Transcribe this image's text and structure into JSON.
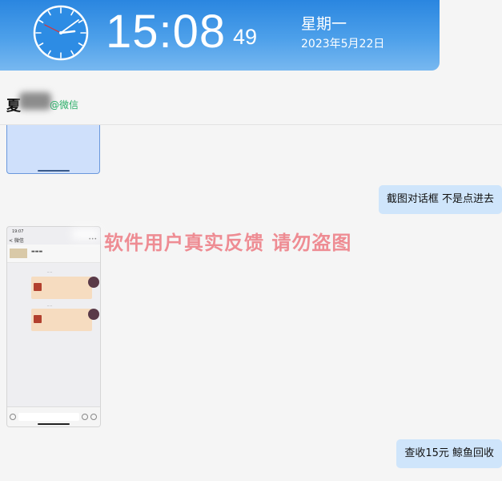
{
  "clock": {
    "time": "15:08",
    "seconds": "49",
    "weekday": "星期一",
    "date": "2023年5月22日"
  },
  "chat": {
    "contact_name": "夏",
    "contact_tag": "@微信"
  },
  "messages": {
    "bubble_1": "截图对话框  不是点进去",
    "bubble_2": "查收15元 鲸鱼回收"
  },
  "screenshot": {
    "status_time": "19:07",
    "back_label": "< 微信",
    "more_label": "•••"
  },
  "watermark": "软件用户真实反馈  请勿盗图",
  "colors": {
    "banner_top": "#2a86e0",
    "bubble": "#cfe5fb",
    "watermark": "#ee8c93",
    "tag_green": "#2aae67"
  }
}
